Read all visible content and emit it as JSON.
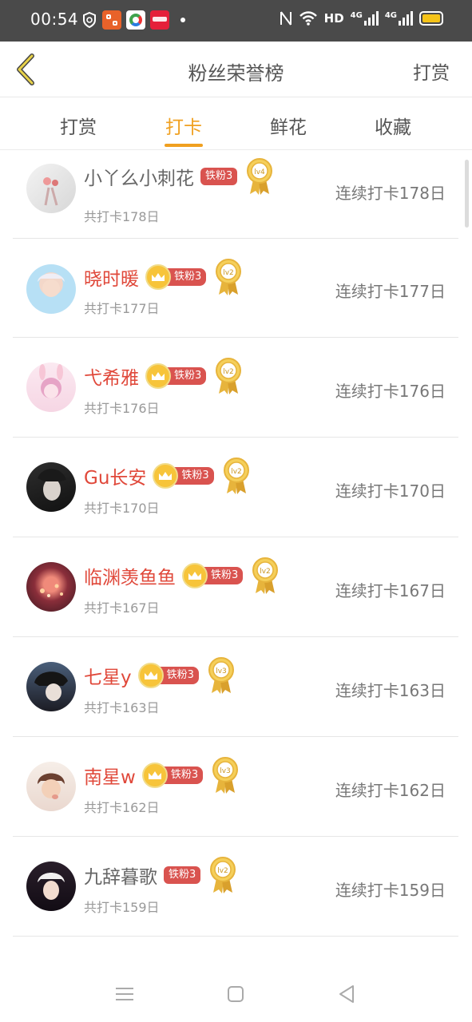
{
  "status_bar": {
    "time": "00:54",
    "network_text": "HD",
    "signal1_label": "4G",
    "signal2_label": "4G",
    "app_icons": [
      "shield-icon",
      "app-orange-icon",
      "app-photos-icon",
      "app-redbook-icon"
    ],
    "battery_color": "#f5c318"
  },
  "nav": {
    "title": "粉丝荣誉榜",
    "action": "打赏"
  },
  "tabs": [
    {
      "label": "打赏",
      "active": false
    },
    {
      "label": "打卡",
      "active": true
    },
    {
      "label": "鲜花",
      "active": false
    },
    {
      "label": "收藏",
      "active": false
    }
  ],
  "rows": [
    {
      "name": "小丫么小刺花",
      "vip": false,
      "fan_badge": "铁粉3",
      "level": "lv4",
      "total": "共打卡178日",
      "streak": "连续打卡178日"
    },
    {
      "name": "晓时暖",
      "vip": true,
      "fan_badge": "铁粉3",
      "level": "lv2",
      "total": "共打卡177日",
      "streak": "连续打卡177日"
    },
    {
      "name": "弋希雅",
      "vip": true,
      "fan_badge": "铁粉3",
      "level": "lv2",
      "total": "共打卡176日",
      "streak": "连续打卡176日"
    },
    {
      "name": "Gu长安",
      "vip": true,
      "fan_badge": "铁粉3",
      "level": "lv2",
      "total": "共打卡170日",
      "streak": "连续打卡170日"
    },
    {
      "name": "临渊羡鱼鱼",
      "vip": true,
      "fan_badge": "铁粉3",
      "level": "lv2",
      "total": "共打卡167日",
      "streak": "连续打卡167日"
    },
    {
      "name": "七星y",
      "vip": true,
      "fan_badge": "铁粉3",
      "level": "lv3",
      "total": "共打卡163日",
      "streak": "连续打卡163日"
    },
    {
      "name": "南星w",
      "vip": true,
      "fan_badge": "铁粉3",
      "level": "lv3",
      "total": "共打卡162日",
      "streak": "连续打卡162日"
    },
    {
      "name": "九辞暮歌",
      "vip": false,
      "fan_badge": "铁粉3",
      "level": "lv2",
      "total": "共打卡159日",
      "streak": "连续打卡159日"
    }
  ],
  "colors": {
    "accent": "#f0a020",
    "vip_name": "#e0483a",
    "fan_badge": "#d9534f",
    "crown": "#f7c43a",
    "medal_gold": "#e7b43c"
  }
}
